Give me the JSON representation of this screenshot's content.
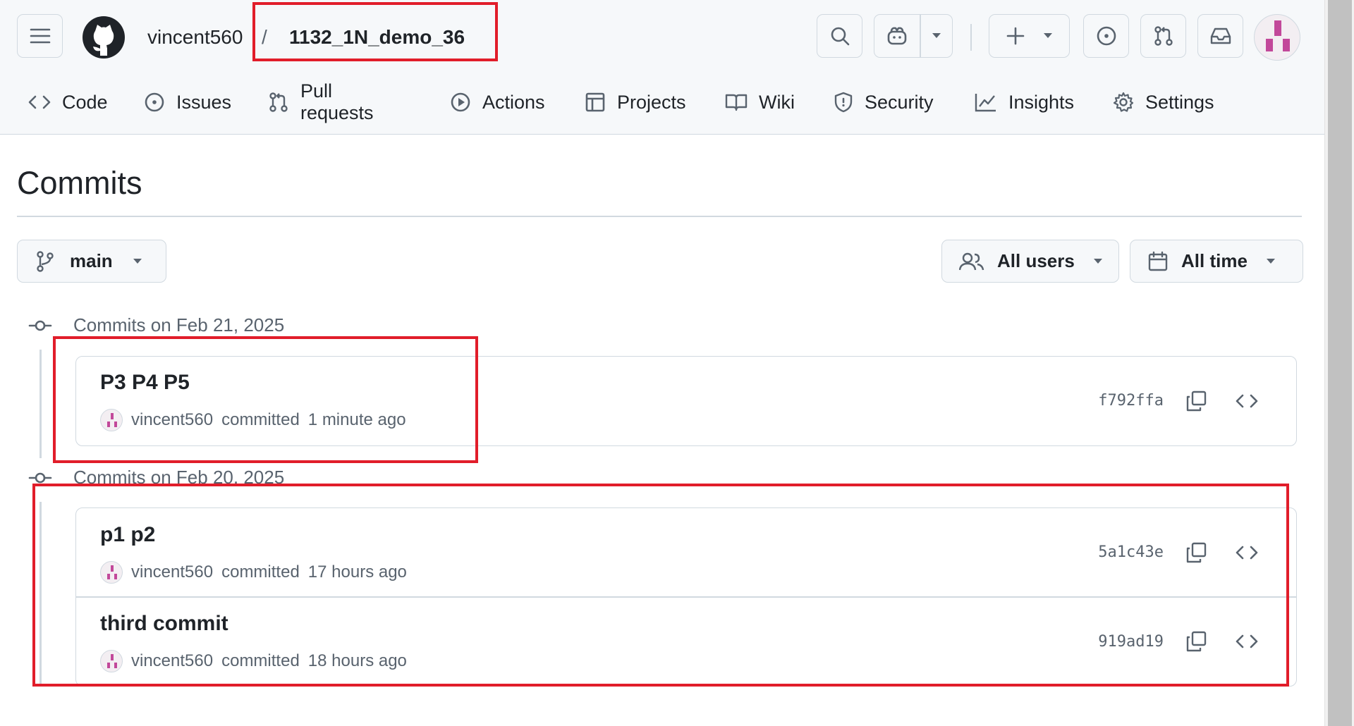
{
  "header": {
    "owner": "vincent560",
    "separator": "/",
    "repo": "1132_1N_demo_36",
    "icons": [
      "hamburger-icon",
      "github-logo-icon",
      "search-icon",
      "copilot-icon",
      "chevron-down-icon",
      "plus-icon",
      "issue-opened-icon",
      "pull-request-icon",
      "inbox-icon"
    ]
  },
  "tabs": [
    {
      "label": "Code",
      "icon": "code-icon"
    },
    {
      "label": "Issues",
      "icon": "issue-opened-icon"
    },
    {
      "label": "Pull requests",
      "icon": "pull-request-icon"
    },
    {
      "label": "Actions",
      "icon": "play-icon"
    },
    {
      "label": "Projects",
      "icon": "table-icon"
    },
    {
      "label": "Wiki",
      "icon": "book-icon"
    },
    {
      "label": "Security",
      "icon": "shield-icon"
    },
    {
      "label": "Insights",
      "icon": "graph-icon"
    },
    {
      "label": "Settings",
      "icon": "gear-icon"
    }
  ],
  "page": {
    "title": "Commits",
    "branch": "main",
    "users_filter": "All users",
    "time_filter": "All time"
  },
  "groups": [
    {
      "heading": "Commits on Feb 21, 2025",
      "commits": [
        {
          "message": "P3 P4 P5",
          "author": "vincent560",
          "action": "committed",
          "time": "1 minute ago",
          "sha": "f792ffa"
        }
      ]
    },
    {
      "heading": "Commits on Feb 20, 2025",
      "commits": [
        {
          "message": "p1 p2",
          "author": "vincent560",
          "action": "committed",
          "time": "17 hours ago",
          "sha": "5a1c43e"
        },
        {
          "message": "third commit",
          "author": "vincent560",
          "action": "committed",
          "time": "18 hours ago",
          "sha": "919ad19"
        }
      ]
    }
  ],
  "colors": {
    "highlight": "#e11d2a",
    "border": "#d1d9e0",
    "muted": "#59636e",
    "avatar_pink": "#c2489a"
  }
}
